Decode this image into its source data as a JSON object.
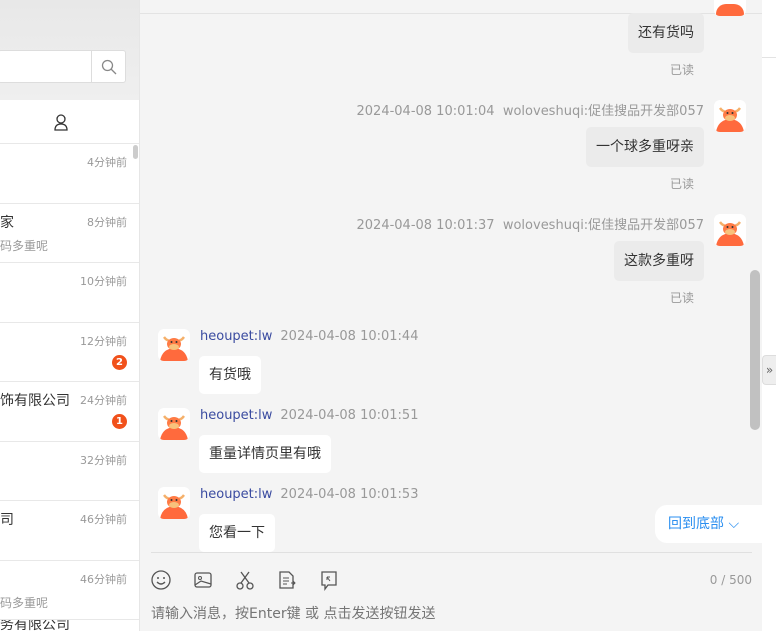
{
  "sidebar": {
    "search_placeholder": "",
    "items": [
      {
        "name": "",
        "sub": "",
        "time": "4分钟前"
      },
      {
        "name": "家",
        "sub": "码多重呢",
        "time": "8分钟前"
      },
      {
        "name": "",
        "sub": "",
        "time": "10分钟前"
      },
      {
        "name": "",
        "sub": "",
        "time": "12分钟前",
        "badge": "2"
      },
      {
        "name": "饰有限公司",
        "sub": "",
        "time": "24分钟前",
        "badge": "1"
      },
      {
        "name": "",
        "sub": "",
        "time": "32分钟前"
      },
      {
        "name": "司",
        "sub": "",
        "time": "46分钟前"
      },
      {
        "name": "",
        "sub": "码多重呢",
        "time": "46分钟前"
      },
      {
        "name": "务有限公司",
        "sub": "",
        "time": ""
      }
    ]
  },
  "chat": {
    "messages": [
      {
        "side": "right",
        "text": "还有货吗",
        "status": "已读"
      },
      {
        "side": "right",
        "time": "2024-04-08 10:01:04",
        "sender": "woloveshuqi:促佳搜品开发部057",
        "text": "一个球多重呀亲",
        "status": "已读"
      },
      {
        "side": "right",
        "time": "2024-04-08 10:01:37",
        "sender": "woloveshuqi:促佳搜品开发部057",
        "text": "这款多重呀",
        "status": "已读"
      },
      {
        "side": "left",
        "sender": "heoupet:lw",
        "time": "2024-04-08 10:01:44",
        "text": "有货哦"
      },
      {
        "side": "left",
        "sender": "heoupet:lw",
        "time": "2024-04-08 10:01:51",
        "text": "重量详情页里有哦"
      },
      {
        "side": "left",
        "sender": "heoupet:lw",
        "time": "2024-04-08 10:01:53",
        "text": "您看一下"
      }
    ],
    "back_to_bottom": "回到底部",
    "char_count": "0 / 500",
    "input_placeholder": "请输入消息，按Enter键 或 点击发送按钮发送",
    "collapse_icon": "»"
  },
  "colors": {
    "accent": "#2b8ff0",
    "badge": "#f1511b",
    "avatar": "#ff6a3d"
  }
}
